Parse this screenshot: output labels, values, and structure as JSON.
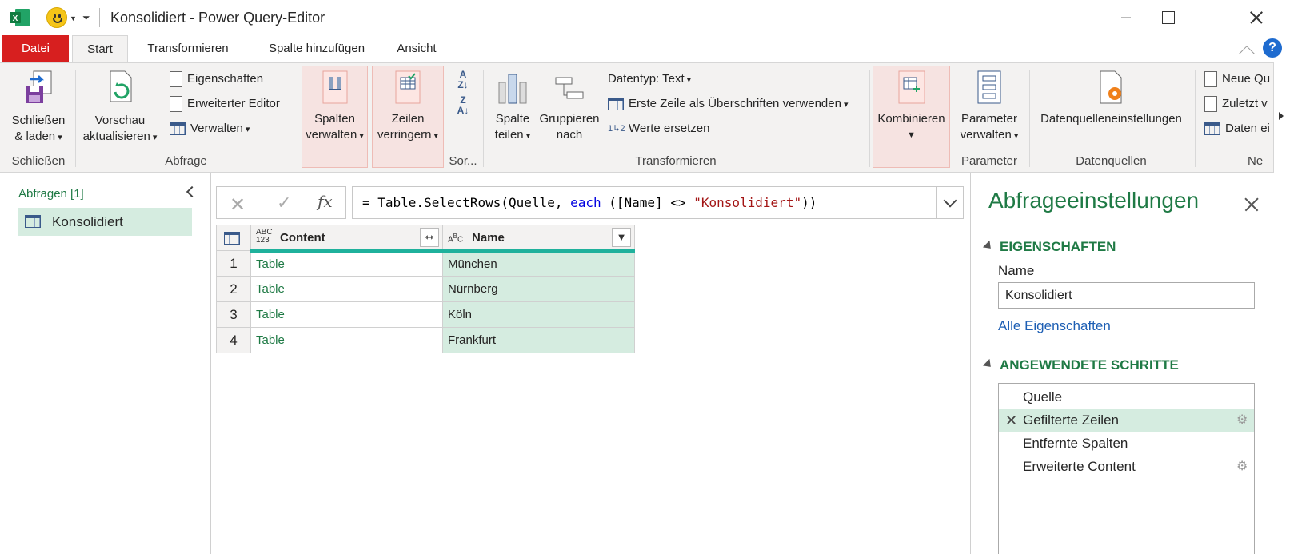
{
  "window": {
    "title": "Konsolidiert - Power Query-Editor"
  },
  "tabs": [
    {
      "label": "Datei"
    },
    {
      "label": "Start"
    },
    {
      "label": "Transformieren"
    },
    {
      "label": "Spalte hinzufügen"
    },
    {
      "label": "Ansicht"
    }
  ],
  "ribbon": {
    "close_load": {
      "line1": "Schließen",
      "line2": "& laden"
    },
    "group_close": "Schließen",
    "refresh": {
      "line1": "Vorschau",
      "line2": "aktualisieren"
    },
    "properties": "Eigenschaften",
    "advanced_editor": "Erweiterter Editor",
    "manage": "Verwalten",
    "group_query": "Abfrage",
    "manage_columns": {
      "line1": "Spalten",
      "line2": "verwalten"
    },
    "reduce_rows": {
      "line1": "Zeilen",
      "line2": "verringern"
    },
    "group_sort": "Sor...",
    "split_column": {
      "line1": "Spalte",
      "line2": "teilen"
    },
    "group_by": {
      "line1": "Gruppieren",
      "line2": "nach"
    },
    "data_type": "Datentyp: Text",
    "first_row_headers": "Erste Zeile als Überschriften verwenden",
    "replace_values": "Werte ersetzen",
    "group_transform": "Transformieren",
    "combine": "Kombinieren",
    "manage_params": {
      "line1": "Parameter",
      "line2": "verwalten"
    },
    "group_params": "Parameter",
    "datasource_settings": "Datenquelleneinstellungen",
    "group_datasources": "Datenquellen",
    "new_query": "Neue Qu",
    "recent": "Zuletzt v",
    "enter_data": "Daten ei",
    "group_new": "Ne"
  },
  "left_panel": {
    "queries_label": "Abfragen [1]",
    "queries": [
      "Konsolidiert"
    ]
  },
  "formula_bar": {
    "prefix": "= Table.SelectRows(Quelle, ",
    "keyword": "each",
    "middle": " ([Name] <> ",
    "string": "\"Konsolidiert\"",
    "suffix": "))"
  },
  "grid": {
    "columns": [
      {
        "type": "ABC\n123",
        "name": "Content"
      },
      {
        "type": "ABC",
        "name": "Name"
      }
    ],
    "rows": [
      {
        "n": "1",
        "content": "Table",
        "name": "München"
      },
      {
        "n": "2",
        "content": "Table",
        "name": "Nürnberg"
      },
      {
        "n": "3",
        "content": "Table",
        "name": "Köln"
      },
      {
        "n": "4",
        "content": "Table",
        "name": "Frankfurt"
      }
    ]
  },
  "right_panel": {
    "title": "Abfrageeinstellungen",
    "properties_header": "EIGENSCHAFTEN",
    "name_label": "Name",
    "name_value": "Konsolidiert",
    "all_properties": "Alle Eigenschaften",
    "steps_header": "ANGEWENDETE SCHRITTE",
    "steps": [
      {
        "label": "Quelle"
      },
      {
        "label": "Gefilterte Zeilen"
      },
      {
        "label": "Entfernte Spalten"
      },
      {
        "label": "Erweiterte Content"
      }
    ]
  },
  "colors": {
    "file_tab": "#d71f1f",
    "accent_green": "#1f7a45",
    "selection": "#d5ece0",
    "column_bar": "#1fb19c"
  }
}
